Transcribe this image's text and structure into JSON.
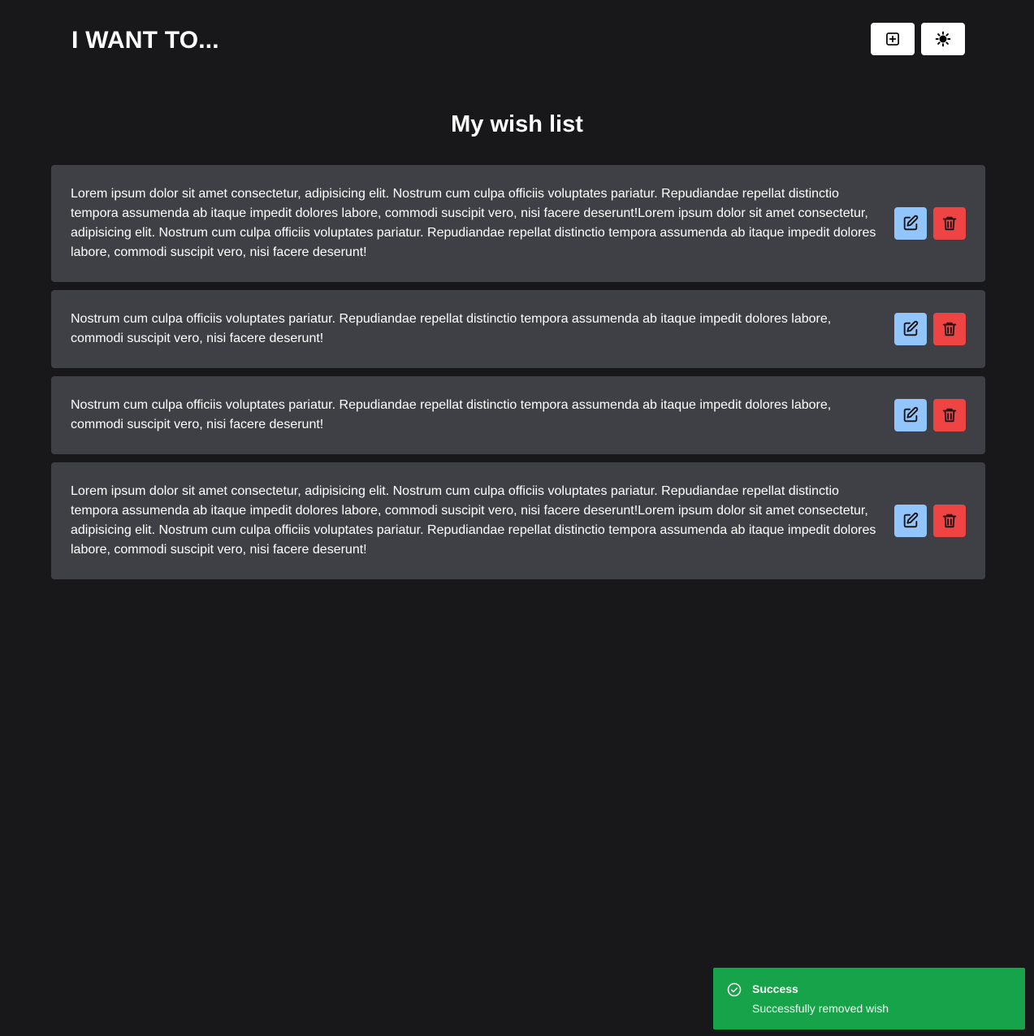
{
  "header": {
    "title": "I WANT TO...",
    "add_icon": "plus-square-icon",
    "theme_icon": "sun-icon"
  },
  "main": {
    "title": "My wish list",
    "wishes": [
      {
        "text": "Lorem ipsum dolor sit amet consectetur, adipisicing elit. Nostrum cum culpa officiis voluptates pariatur. Repudiandae repellat distinctio tempora assumenda ab itaque impedit dolores labore, commodi suscipit vero, nisi facere deserunt!Lorem ipsum dolor sit amet consectetur, adipisicing elit. Nostrum cum culpa officiis voluptates pariatur. Repudiandae repellat distinctio tempora assumenda ab itaque impedit dolores labore, commodi suscipit vero, nisi facere deserunt!"
      },
      {
        "text": "Nostrum cum culpa officiis voluptates pariatur. Repudiandae repellat distinctio tempora assumenda ab itaque impedit dolores labore, commodi suscipit vero, nisi facere deserunt!"
      },
      {
        "text": "Nostrum cum culpa officiis voluptates pariatur. Repudiandae repellat distinctio tempora assumenda ab itaque impedit dolores labore, commodi suscipit vero, nisi facere deserunt!"
      },
      {
        "text": "Lorem ipsum dolor sit amet consectetur, adipisicing elit. Nostrum cum culpa officiis voluptates pariatur. Repudiandae repellat distinctio tempora assumenda ab itaque impedit dolores labore, commodi suscipit vero, nisi facere deserunt!Lorem ipsum dolor sit amet consectetur, adipisicing elit. Nostrum cum culpa officiis voluptates pariatur. Repudiandae repellat distinctio tempora assumenda ab itaque impedit dolores labore, commodi suscipit vero, nisi facere deserunt!"
      }
    ],
    "edit_icon": "edit-icon",
    "delete_icon": "trash-icon"
  },
  "toast": {
    "title": "Success",
    "message": "Successfully removed wish",
    "icon": "check-circle-icon"
  },
  "colors": {
    "background": "#18181b",
    "card": "#3f3f46",
    "edit": "#93c5fd",
    "delete": "#ef4444",
    "success": "#16a34a"
  }
}
